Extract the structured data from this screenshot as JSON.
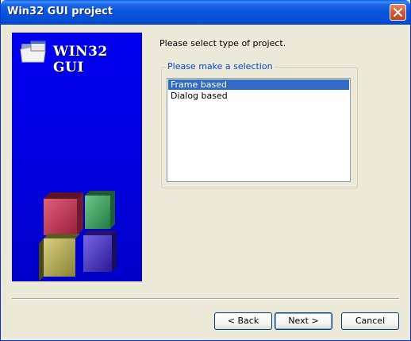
{
  "window": {
    "title": "Win32 GUI project"
  },
  "banner": {
    "logo_text": "WIN32 GUI",
    "background_color": "#0000e0",
    "cube_colors": [
      "#c83c5a",
      "#3c9c5c",
      "#b6ad5a",
      "#4a32c4"
    ]
  },
  "content": {
    "prompt": "Please select type of project.",
    "group_title": "Please make a selection",
    "options": [
      {
        "label": "Frame based",
        "selected": true
      },
      {
        "label": "Dialog based",
        "selected": false
      }
    ]
  },
  "buttons": {
    "back": "< Back",
    "next": "Next >",
    "cancel": "Cancel"
  },
  "icons": {
    "close": "close-icon",
    "logo": "folder-window-icon",
    "graphic": "cubes-icon"
  },
  "colors": {
    "titlebar": "#0854dd",
    "selection": "#316ac5",
    "group_title": "#0046d5"
  }
}
